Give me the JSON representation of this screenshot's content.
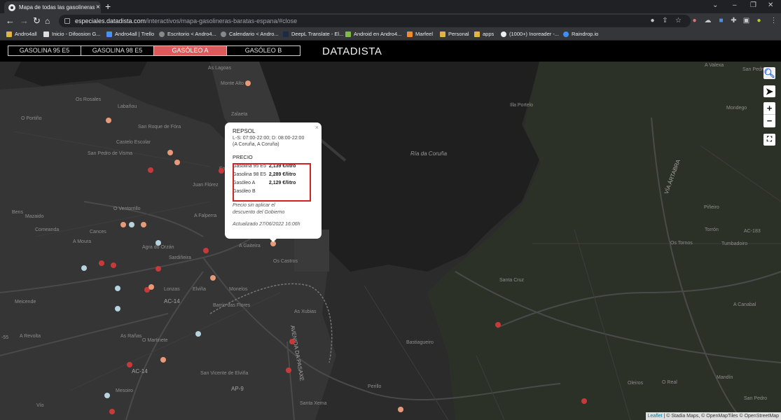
{
  "browser": {
    "tab_title": "Mapa de todas las gasolineras de",
    "url_host": "especiales.datadista.com",
    "url_path": "/interactivos/mapa-gasolineras-baratas-espana/#close",
    "bookmarks": [
      "Andro4all",
      "Inicio - Difoosion G...",
      "Andro4all | Trello",
      "Escritorio < Andro4...",
      "Calendario < Andro...",
      "DeepL Translate - El...",
      "Android en Andro4...",
      "Marfeel",
      "Personal",
      "apps",
      "(1000+) Inoreader -...",
      "Raindrop.io"
    ]
  },
  "header": {
    "tabs": [
      {
        "label": "GASOLINA 95 E5",
        "active": false
      },
      {
        "label": "GASOLINA 98 E5",
        "active": false
      },
      {
        "label": "GASÓLEO A",
        "active": true
      },
      {
        "label": "GASÓLEO B",
        "active": false
      }
    ],
    "brand": "DATADISTA"
  },
  "popup": {
    "name": "REPSOL",
    "hours": "L-S: 07:00-22:00; D: 08:00-22:00",
    "location": "(A Coruña, A Coruña)",
    "price_title": "PRECIO",
    "prices": [
      {
        "fuel": "Gasolina 95 E5",
        "value": "2,139 €/litro"
      },
      {
        "fuel": "Gasolina 98 E5",
        "value": "2,289 €/litro"
      },
      {
        "fuel": "Gasóleo A",
        "value": "2,129 €/litro"
      },
      {
        "fuel": "Gasóleo B",
        "value": ""
      }
    ],
    "note_line1": "Precio sin aplicar el",
    "note_line2": "descuento del Gobierno",
    "updated": "Actualizado 27/06/2022 16:06h"
  },
  "map": {
    "labels": [
      {
        "text": "Ría da Coruña",
        "kind": "water"
      },
      {
        "text": "Monte Alto",
        "kind": "place"
      },
      {
        "text": "Zalaeta",
        "kind": "place"
      },
      {
        "text": "As Lagoas",
        "kind": "place"
      },
      {
        "text": "Os Rosales",
        "kind": "place"
      },
      {
        "text": "Labañou",
        "kind": "place"
      },
      {
        "text": "O Portiño",
        "kind": "place"
      },
      {
        "text": "San Roque de Fóra",
        "kind": "place"
      },
      {
        "text": "Castelo Escolar",
        "kind": "place"
      },
      {
        "text": "San Pedro de Visma",
        "kind": "place"
      },
      {
        "text": "Ensanche",
        "kind": "place"
      },
      {
        "text": "Juan Flórez",
        "kind": "place"
      },
      {
        "text": "Bens",
        "kind": "place"
      },
      {
        "text": "Mazaido",
        "kind": "place"
      },
      {
        "text": "O Ventorrillo",
        "kind": "place"
      },
      {
        "text": "A Falperra",
        "kind": "place"
      },
      {
        "text": "Comeanda",
        "kind": "place"
      },
      {
        "text": "Cances",
        "kind": "place"
      },
      {
        "text": "A Moura",
        "kind": "place"
      },
      {
        "text": "A Gaiteira",
        "kind": "place"
      },
      {
        "text": "Os Castros",
        "kind": "place"
      },
      {
        "text": "Agra do Orzán",
        "kind": "place"
      },
      {
        "text": "Sardiñeira",
        "kind": "place"
      },
      {
        "text": "Lonzas",
        "kind": "place"
      },
      {
        "text": "Elviña",
        "kind": "place"
      },
      {
        "text": "Monelos",
        "kind": "place"
      },
      {
        "text": "O Martinete",
        "kind": "place"
      },
      {
        "text": "Meicende",
        "kind": "place"
      },
      {
        "text": "Barrio das Flores",
        "kind": "place"
      },
      {
        "text": "AC-14",
        "kind": "road"
      },
      {
        "text": "A Revolta",
        "kind": "place"
      },
      {
        "text": "As Rañas",
        "kind": "place"
      },
      {
        "text": "San Vicente de Elviña",
        "kind": "place"
      },
      {
        "text": "As Xubias",
        "kind": "place"
      },
      {
        "text": "Mesoiro",
        "kind": "place"
      },
      {
        "text": "AP-9",
        "kind": "road"
      },
      {
        "text": "Santa Xema",
        "kind": "place"
      },
      {
        "text": "Perillo",
        "kind": "place"
      },
      {
        "text": "Bastiagueiro",
        "kind": "place"
      },
      {
        "text": "Santa Cruz",
        "kind": "place"
      },
      {
        "text": "Illa Portelo",
        "kind": "place"
      },
      {
        "text": "A Valexa",
        "kind": "place"
      },
      {
        "text": "San Pedro",
        "kind": "place"
      },
      {
        "text": "Mondego",
        "kind": "place"
      },
      {
        "text": "Piñeiro",
        "kind": "place"
      },
      {
        "text": "Torrón",
        "kind": "place"
      },
      {
        "text": "Tumbadoiro",
        "kind": "place"
      },
      {
        "text": "Os Tornos",
        "kind": "place"
      },
      {
        "text": "A Canabal",
        "kind": "place"
      },
      {
        "text": "Oleiros",
        "kind": "place"
      },
      {
        "text": "O Real",
        "kind": "place"
      },
      {
        "text": "Mandín",
        "kind": "place"
      },
      {
        "text": "San Pedro",
        "kind": "place"
      },
      {
        "text": "VÍA ÁRTABRA",
        "kind": "road"
      },
      {
        "text": "AVENIDA DA PASAXE",
        "kind": "road"
      },
      {
        "text": "AC-183",
        "kind": "road"
      },
      {
        "text": "AC-14",
        "kind": "road"
      },
      {
        "text": "Vío",
        "kind": "place"
      },
      {
        "text": "-55",
        "kind": "road"
      }
    ],
    "attribution": {
      "leaflet": "Leaflet",
      "rest": " | © Stadia Maps, © OpenMapTiles © OpenStreetMap"
    },
    "marker_colors": {
      "cheap": "#b8d3e0",
      "mid": "#e89a78",
      "expensive": "#c83a3a"
    }
  }
}
